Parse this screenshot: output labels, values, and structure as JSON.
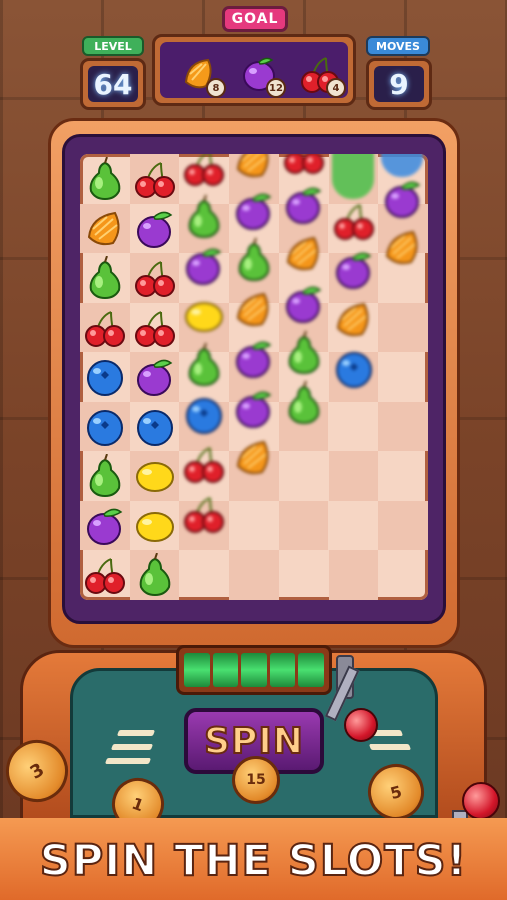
{
  "hud": {
    "goal_label": "GOAL",
    "level_label": "LEVEL",
    "level_value": "64",
    "moves_label": "MOVES",
    "moves_value": "9",
    "goals": [
      {
        "fruit": "orange",
        "count": "8"
      },
      {
        "fruit": "plum",
        "count": "12"
      },
      {
        "fruit": "cherry",
        "count": "4"
      }
    ]
  },
  "board": {
    "columns": [
      [
        "pear",
        "orange",
        "pear",
        "cherry",
        "blueberry",
        "blueberry",
        "pear",
        "plum",
        "cherry"
      ],
      [
        "cherry",
        "plum",
        "cherry",
        "cherry",
        "plum",
        "blueberry",
        "lemon",
        "lemon",
        "pear"
      ],
      [
        "cherry",
        "pear",
        "plum",
        "lemon",
        "pear",
        "blueberry",
        "cherry",
        "cherry"
      ],
      [
        "orange",
        "plum",
        "pear",
        "orange",
        "plum",
        "plum",
        "orange"
      ],
      [
        "cherry",
        "plum",
        "orange",
        "plum",
        "pear",
        "pear"
      ],
      [
        "green",
        "cherry",
        "plum",
        "orange",
        "blueberry"
      ],
      [
        "blue",
        "plum",
        "orange"
      ]
    ]
  },
  "machine": {
    "spin_label": "SPIN",
    "spin_cost": "15",
    "coins": [
      "3",
      "1",
      "5"
    ]
  },
  "banner": {
    "text": "SPIN THE SLOTS!"
  },
  "colors": {
    "goal_tag": "#e5397e",
    "level_tag": "#3fb05a",
    "moves_tag": "#3a8ad8"
  }
}
